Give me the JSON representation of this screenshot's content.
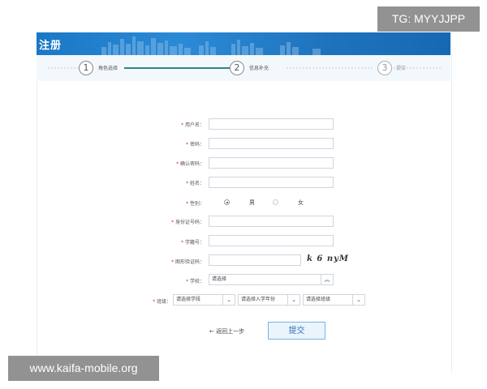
{
  "header": {
    "title": "注册"
  },
  "steps": [
    {
      "num": "1",
      "label": "角色选择"
    },
    {
      "num": "2",
      "label": "信息补充"
    },
    {
      "num": "3",
      "label": "提交"
    }
  ],
  "colors": {
    "header": "#1a78c6",
    "progress": "#2a8a7e",
    "required": "#d33333",
    "submit_text": "#2d74b6"
  },
  "form": {
    "required_mark": "*",
    "username_label": "用户名：",
    "password_label": "密码：",
    "confirm_label": "确认密码：",
    "name_label": "姓名：",
    "gender_label": "性别：",
    "gender_male": "男",
    "gender_female": "女",
    "id_label": "身份证号码：",
    "student_no_label": "学籍号：",
    "captcha_label": "图形验证码：",
    "captcha_text": "k 6 nyM",
    "school_label": "学校：",
    "school_value": "请选择",
    "class_label": "班级：",
    "stage_value": "请选择学段",
    "year_value": "请选择入学年份",
    "class_value": "请选择班级"
  },
  "actions": {
    "back_label": "返回上一步",
    "submit_label": "提交"
  },
  "overlays": {
    "tg": "TG: MYYJJPP",
    "site": "www.kaifa-mobile.org"
  }
}
